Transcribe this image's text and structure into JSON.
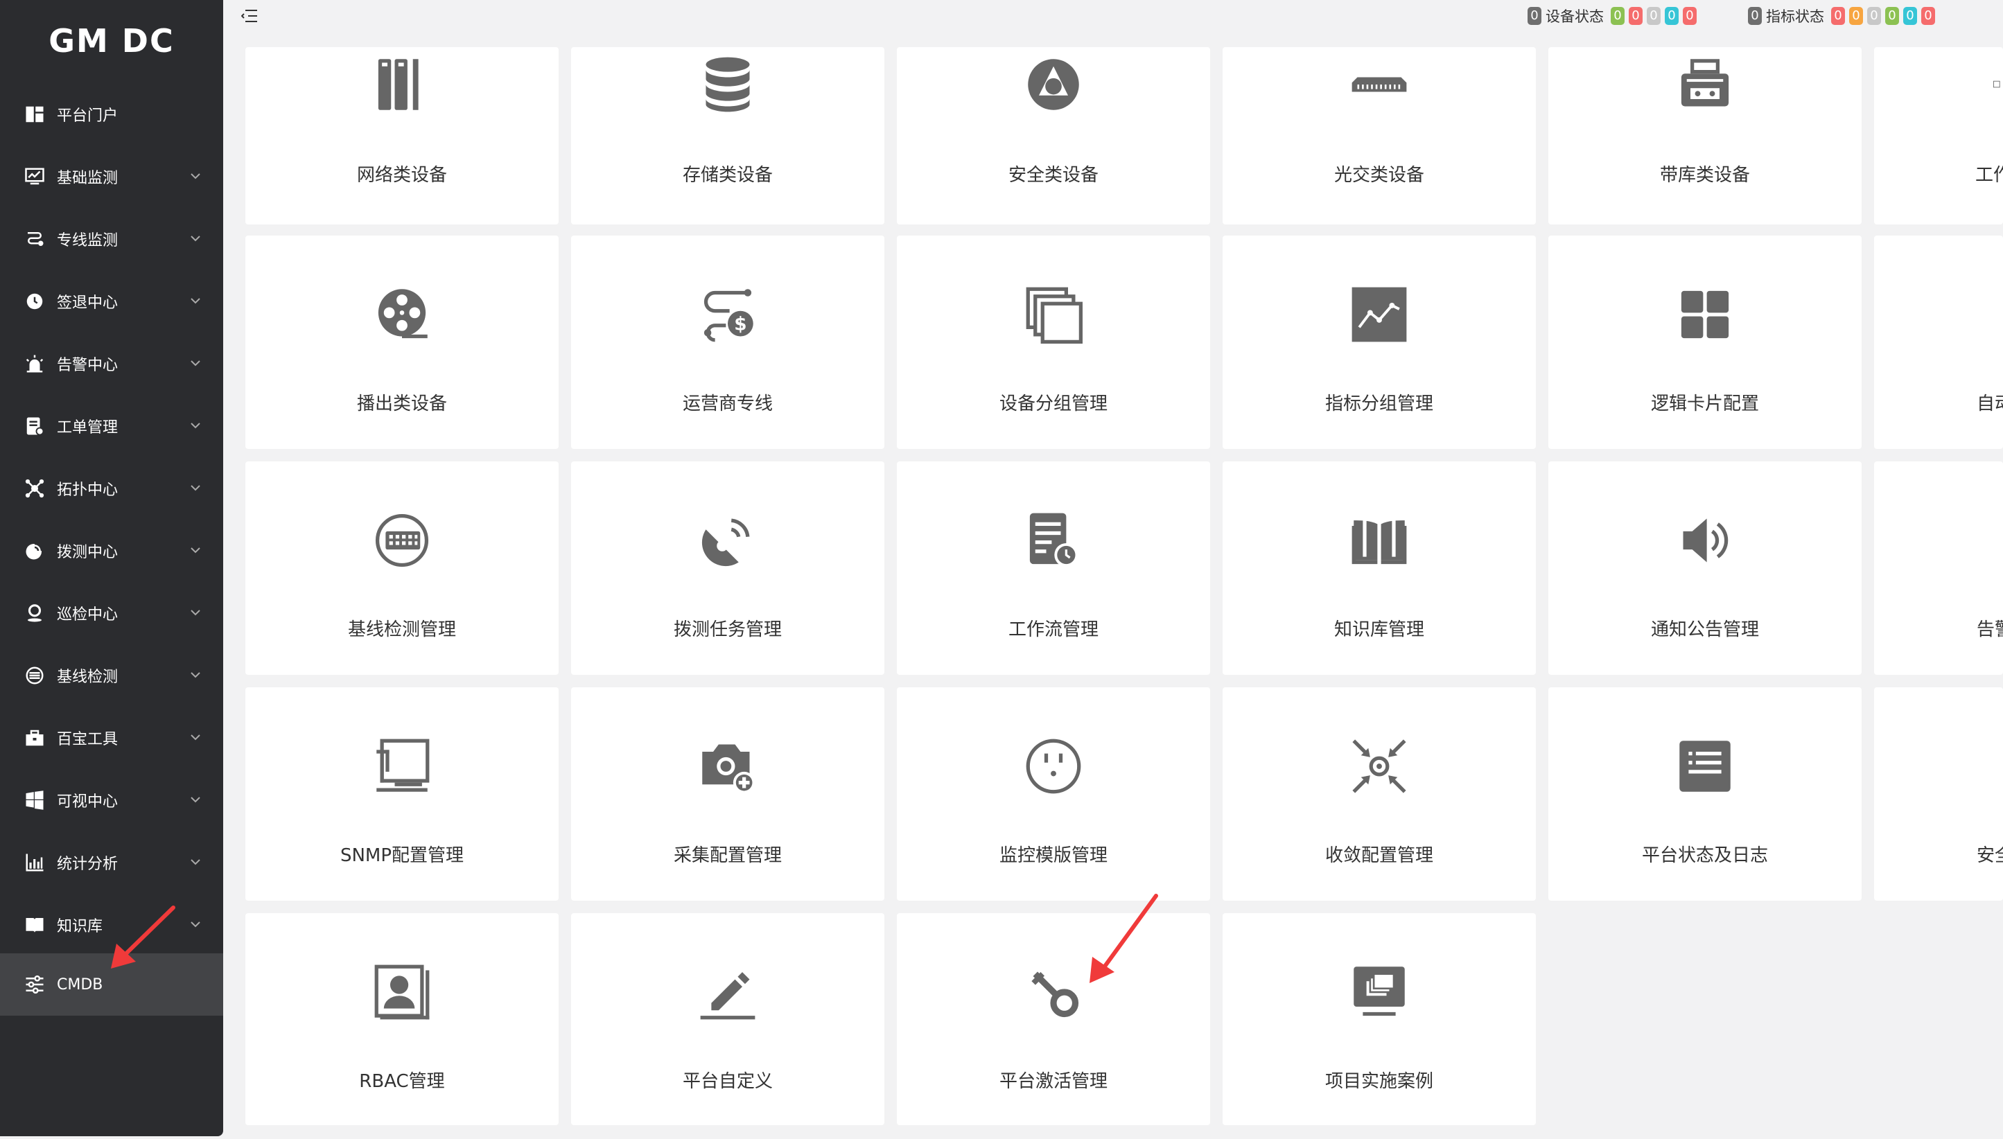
{
  "brand": "GM DC",
  "sidebar": {
    "items": [
      {
        "label": "平台门户",
        "icon": "dashboard-icon"
      },
      {
        "label": "基础监测",
        "icon": "monitor-chart-icon"
      },
      {
        "label": "专线监测",
        "icon": "route-icon"
      },
      {
        "label": "签退中心",
        "icon": "clock-icon"
      },
      {
        "label": "告警中心",
        "icon": "alarm-icon"
      },
      {
        "label": "工单管理",
        "icon": "ticket-icon"
      },
      {
        "label": "拓扑中心",
        "icon": "topology-icon"
      },
      {
        "label": "拨测中心",
        "icon": "probe-icon"
      },
      {
        "label": "巡检中心",
        "icon": "location-pin-icon"
      },
      {
        "label": "基线检测",
        "icon": "baseline-icon"
      },
      {
        "label": "百宝工具",
        "icon": "toolbox-icon"
      },
      {
        "label": "可视中心",
        "icon": "windows-icon"
      },
      {
        "label": "统计分析",
        "icon": "bar-chart-icon"
      },
      {
        "label": "知识库",
        "icon": "book-icon"
      },
      {
        "label": "CMDB",
        "icon": "sliders-icon"
      }
    ]
  },
  "topbar": {
    "device_status_count": "0",
    "device_status_label": "设备状态",
    "device_badges": [
      "0",
      "0",
      "0",
      "0",
      "0"
    ],
    "metric_status_count": "0",
    "metric_status_label": "指标状态",
    "metric_badges": [
      "0",
      "0",
      "0",
      "0",
      "0",
      "0"
    ]
  },
  "colors": {
    "sidebar_bg": "#2b2c2f",
    "sidebar_active": "#434447",
    "badge_gray": "#6e6e6e",
    "badge_green": "#8cc152",
    "badge_red": "#f56c6c",
    "badge_light": "#c8c8c8",
    "badge_teal": "#36c5d6",
    "badge_orange": "#f7a540",
    "arrow_red": "#f03a3a"
  },
  "tiles": [
    [
      "网络类设备",
      "存储类设备",
      "安全类设备",
      "光交类设备",
      "带库类设备",
      "工作"
    ],
    [
      "播出类设备",
      "运营商专线",
      "设备分组管理",
      "指标分组管理",
      "逻辑卡片配置",
      "自动"
    ],
    [
      "基线检测管理",
      "拨测任务管理",
      "工作流管理",
      "知识库管理",
      "通知公告管理",
      "告警"
    ],
    [
      "SNMP配置管理",
      "采集配置管理",
      "监控模版管理",
      "收敛配置管理",
      "平台状态及日志",
      "安全"
    ],
    [
      "RBAC管理",
      "平台自定义",
      "平台激活管理",
      "项目实施案例"
    ]
  ]
}
